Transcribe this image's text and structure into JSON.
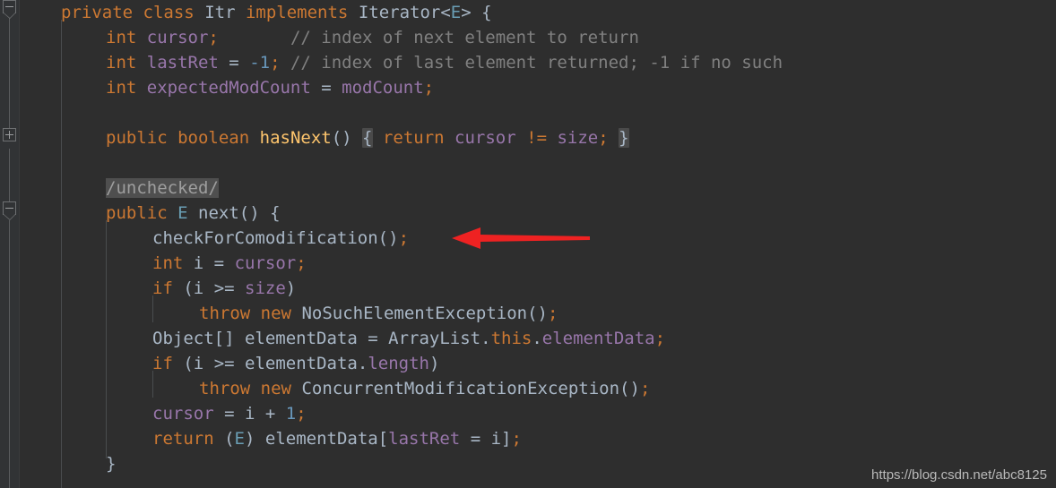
{
  "editor": {
    "theme_name": "darcula",
    "background_color": "#2e2e2e",
    "gutter_color": "#313335",
    "default_text_color": "#a9b7c6",
    "keyword_color": "#cc7832",
    "field_color": "#9876aa",
    "comment_color": "#808080",
    "number_color": "#6897bb",
    "method_color": "#ffc66d",
    "generic_color": "#6a9fb5",
    "highlight_color": "#4f4f4f",
    "arrow_color": "#ee2222"
  },
  "gutter": {
    "markers": [
      {
        "name": "fold-marker-class",
        "state": "expanded",
        "glyph": "minus"
      },
      {
        "name": "fold-marker-javadoc",
        "state": "collapsed",
        "glyph": "plus"
      },
      {
        "name": "fold-marker-method-next",
        "state": "expanded",
        "glyph": "minus"
      }
    ]
  },
  "code": {
    "language": "java",
    "lines": [
      {
        "n": 1,
        "indent": 1,
        "text": "private class Itr implements Iterator<E> {"
      },
      {
        "n": 2,
        "indent": 2,
        "text": "int cursor;       // index of next element to return"
      },
      {
        "n": 3,
        "indent": 2,
        "text": "int lastRet = -1; // index of last element returned; -1 if no such"
      },
      {
        "n": 4,
        "indent": 2,
        "text": "int expectedModCount = modCount;"
      },
      {
        "n": 5,
        "indent": 0,
        "text": ""
      },
      {
        "n": 6,
        "indent": 2,
        "text": "public boolean hasNext() { return cursor != size; }"
      },
      {
        "n": 7,
        "indent": 0,
        "text": ""
      },
      {
        "n": 8,
        "indent": 2,
        "text": "/unchecked/"
      },
      {
        "n": 9,
        "indent": 2,
        "text": "public E next() {"
      },
      {
        "n": 10,
        "indent": 3,
        "text": "checkForComodification();"
      },
      {
        "n": 11,
        "indent": 3,
        "text": "int i = cursor;"
      },
      {
        "n": 12,
        "indent": 3,
        "text": "if (i >= size)"
      },
      {
        "n": 13,
        "indent": 4,
        "text": "throw new NoSuchElementException();"
      },
      {
        "n": 14,
        "indent": 3,
        "text": "Object[] elementData = ArrayList.this.elementData;"
      },
      {
        "n": 15,
        "indent": 3,
        "text": "if (i >= elementData.length)"
      },
      {
        "n": 16,
        "indent": 4,
        "text": "throw new ConcurrentModificationException();"
      },
      {
        "n": 17,
        "indent": 3,
        "text": "cursor = i + 1;"
      },
      {
        "n": 18,
        "indent": 3,
        "text": "return (E) elementData[lastRet = i];"
      },
      {
        "n": 19,
        "indent": 2,
        "text": "}"
      }
    ],
    "tokens": {
      "l1": [
        {
          "t": "private",
          "c": "kw"
        },
        {
          "t": " ",
          "c": "plain"
        },
        {
          "t": "class",
          "c": "kw"
        },
        {
          "t": " ",
          "c": "plain"
        },
        {
          "t": "Itr",
          "c": "type"
        },
        {
          "t": " ",
          "c": "plain"
        },
        {
          "t": "implements",
          "c": "kw"
        },
        {
          "t": " ",
          "c": "plain"
        },
        {
          "t": "Iterator",
          "c": "type"
        },
        {
          "t": "<",
          "c": "pun"
        },
        {
          "t": "E",
          "c": "gen"
        },
        {
          "t": ">",
          "c": "pun"
        },
        {
          "t": " {",
          "c": "pun"
        }
      ],
      "l2": [
        {
          "t": "int",
          "c": "kw"
        },
        {
          "t": " ",
          "c": "plain"
        },
        {
          "t": "cursor",
          "c": "fld"
        },
        {
          "t": ";",
          "c": "semi"
        },
        {
          "t": "       ",
          "c": "plain"
        },
        {
          "t": "// index of next element to return",
          "c": "cmt"
        }
      ],
      "l3": [
        {
          "t": "int",
          "c": "kw"
        },
        {
          "t": " ",
          "c": "plain"
        },
        {
          "t": "lastRet",
          "c": "fld"
        },
        {
          "t": " = ",
          "c": "plain"
        },
        {
          "t": "-1",
          "c": "num"
        },
        {
          "t": ";",
          "c": "semi"
        },
        {
          "t": " ",
          "c": "plain"
        },
        {
          "t": "// index of last element returned; -1 if no such",
          "c": "cmt"
        }
      ],
      "l4": [
        {
          "t": "int",
          "c": "kw"
        },
        {
          "t": " ",
          "c": "plain"
        },
        {
          "t": "expectedModCount",
          "c": "fld"
        },
        {
          "t": " = ",
          "c": "plain"
        },
        {
          "t": "modCount",
          "c": "fld"
        },
        {
          "t": ";",
          "c": "semi"
        }
      ],
      "l6": [
        {
          "t": "public",
          "c": "kw"
        },
        {
          "t": " ",
          "c": "plain"
        },
        {
          "t": "boolean",
          "c": "kw"
        },
        {
          "t": " ",
          "c": "plain"
        },
        {
          "t": "hasNext",
          "c": "mtd"
        },
        {
          "t": "()",
          "c": "pun"
        },
        {
          "t": " ",
          "c": "plain"
        },
        {
          "t": "{",
          "c": "pun",
          "hl": true
        },
        {
          "t": " ",
          "c": "plain"
        },
        {
          "t": "return",
          "c": "kw"
        },
        {
          "t": " ",
          "c": "plain"
        },
        {
          "t": "cursor",
          "c": "fld"
        },
        {
          "t": " ",
          "c": "plain"
        },
        {
          "t": "!=",
          "c": "semi"
        },
        {
          "t": " ",
          "c": "plain"
        },
        {
          "t": "size",
          "c": "fld"
        },
        {
          "t": ";",
          "c": "semi"
        },
        {
          "t": " ",
          "c": "plain"
        },
        {
          "t": "}",
          "c": "pun",
          "hl": true
        }
      ],
      "l8": [
        {
          "t": "/unchecked/",
          "c": "cmt",
          "hl": true
        }
      ],
      "l9": [
        {
          "t": "public",
          "c": "kw"
        },
        {
          "t": " ",
          "c": "plain"
        },
        {
          "t": "E",
          "c": "gen"
        },
        {
          "t": " ",
          "c": "plain"
        },
        {
          "t": "next",
          "c": "plain"
        },
        {
          "t": "() {",
          "c": "pun"
        }
      ],
      "l10": [
        {
          "t": "checkForComodification",
          "c": "plain"
        },
        {
          "t": "()",
          "c": "pun"
        },
        {
          "t": ";",
          "c": "semi"
        }
      ],
      "l11": [
        {
          "t": "int",
          "c": "kw"
        },
        {
          "t": " ",
          "c": "plain"
        },
        {
          "t": "i",
          "c": "plain"
        },
        {
          "t": " = ",
          "c": "plain"
        },
        {
          "t": "cursor",
          "c": "fld"
        },
        {
          "t": ";",
          "c": "semi"
        }
      ],
      "l12": [
        {
          "t": "if",
          "c": "kw"
        },
        {
          "t": " (",
          "c": "pun"
        },
        {
          "t": "i",
          "c": "plain"
        },
        {
          "t": " ",
          "c": "plain"
        },
        {
          "t": ">=",
          "c": "plain"
        },
        {
          "t": " ",
          "c": "plain"
        },
        {
          "t": "size",
          "c": "fld"
        },
        {
          "t": ")",
          "c": "pun"
        }
      ],
      "l13": [
        {
          "t": "throw",
          "c": "kw"
        },
        {
          "t": " ",
          "c": "plain"
        },
        {
          "t": "new",
          "c": "kw"
        },
        {
          "t": " ",
          "c": "plain"
        },
        {
          "t": "NoSuchElementException",
          "c": "plain"
        },
        {
          "t": "()",
          "c": "pun"
        },
        {
          "t": ";",
          "c": "semi"
        }
      ],
      "l14": [
        {
          "t": "Object",
          "c": "plain"
        },
        {
          "t": "[]",
          "c": "pun"
        },
        {
          "t": " ",
          "c": "plain"
        },
        {
          "t": "elementData",
          "c": "plain"
        },
        {
          "t": " = ",
          "c": "plain"
        },
        {
          "t": "ArrayList",
          "c": "plain"
        },
        {
          "t": ".",
          "c": "pun"
        },
        {
          "t": "this",
          "c": "kw"
        },
        {
          "t": ".",
          "c": "pun"
        },
        {
          "t": "elementData",
          "c": "fld"
        },
        {
          "t": ";",
          "c": "semi"
        }
      ],
      "l15": [
        {
          "t": "if",
          "c": "kw"
        },
        {
          "t": " (",
          "c": "pun"
        },
        {
          "t": "i",
          "c": "plain"
        },
        {
          "t": " ",
          "c": "plain"
        },
        {
          "t": ">=",
          "c": "plain"
        },
        {
          "t": " ",
          "c": "plain"
        },
        {
          "t": "elementData",
          "c": "plain"
        },
        {
          "t": ".",
          "c": "pun"
        },
        {
          "t": "length",
          "c": "fld"
        },
        {
          "t": ")",
          "c": "pun"
        }
      ],
      "l16": [
        {
          "t": "throw",
          "c": "kw"
        },
        {
          "t": " ",
          "c": "plain"
        },
        {
          "t": "new",
          "c": "kw"
        },
        {
          "t": " ",
          "c": "plain"
        },
        {
          "t": "ConcurrentModificationException",
          "c": "plain"
        },
        {
          "t": "()",
          "c": "pun"
        },
        {
          "t": ";",
          "c": "semi"
        }
      ],
      "l17": [
        {
          "t": "cursor",
          "c": "fld"
        },
        {
          "t": " = ",
          "c": "plain"
        },
        {
          "t": "i",
          "c": "plain"
        },
        {
          "t": " + ",
          "c": "plain"
        },
        {
          "t": "1",
          "c": "num"
        },
        {
          "t": ";",
          "c": "semi"
        }
      ],
      "l18": [
        {
          "t": "return",
          "c": "kw"
        },
        {
          "t": " (",
          "c": "pun"
        },
        {
          "t": "E",
          "c": "gen"
        },
        {
          "t": ") ",
          "c": "pun"
        },
        {
          "t": "elementData",
          "c": "plain"
        },
        {
          "t": "[",
          "c": "pun"
        },
        {
          "t": "lastRet",
          "c": "fld"
        },
        {
          "t": " = ",
          "c": "plain"
        },
        {
          "t": "i",
          "c": "plain"
        },
        {
          "t": "]",
          "c": "pun"
        },
        {
          "t": ";",
          "c": "semi"
        }
      ],
      "l19": [
        {
          "t": "}",
          "c": "pun"
        }
      ]
    }
  },
  "annotation": {
    "arrow": {
      "name": "red-arrow-pointer",
      "color": "#ee2222",
      "points_to": "checkForComodification();",
      "direction": "left"
    }
  },
  "watermark": {
    "text": "https://blog.csdn.net/abc8125"
  }
}
